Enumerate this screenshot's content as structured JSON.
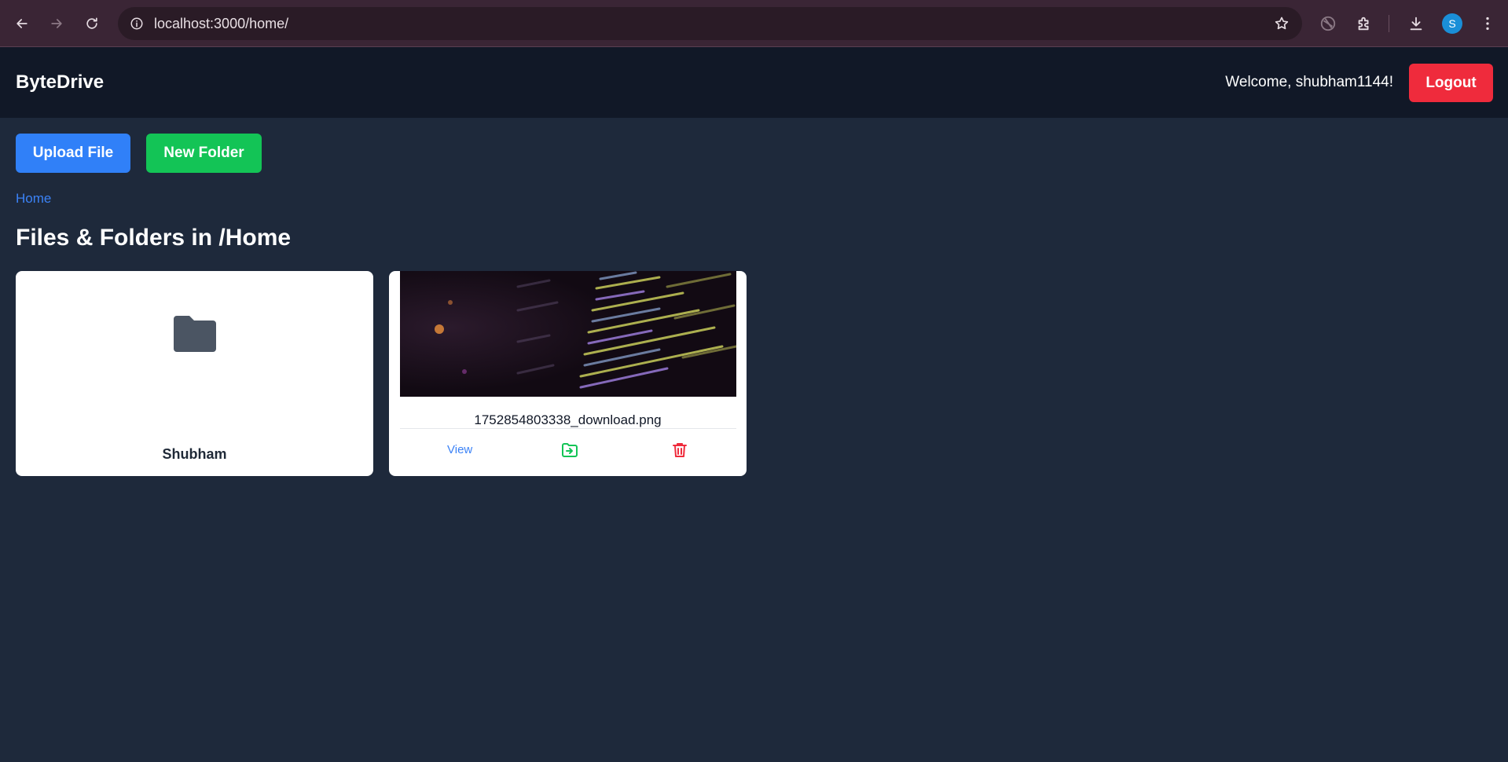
{
  "browser": {
    "url": "localhost:3000/home/",
    "profile_initial": "S",
    "icons": [
      "back-icon",
      "forward-icon",
      "reload-icon",
      "site-info-icon",
      "bookmark-star-icon",
      "browser-extension-icon",
      "extensions-icon",
      "downloads-icon",
      "menu-icon"
    ]
  },
  "header": {
    "brand": "ByteDrive",
    "welcome": "Welcome, shubham1144!",
    "logout_label": "Logout"
  },
  "toolbar": {
    "upload_label": "Upload File",
    "new_folder_label": "New Folder"
  },
  "breadcrumb": {
    "home": "Home"
  },
  "page_title": "Files & Folders in /Home",
  "items": [
    {
      "type": "folder",
      "name": "Shubham",
      "icon": "folder-icon"
    },
    {
      "type": "file",
      "name": "1752854803338_download.png",
      "actions": {
        "view": "View",
        "move_icon": "move-to-folder-icon",
        "delete_icon": "trash-icon"
      }
    }
  ],
  "colors": {
    "background": "#1e293b",
    "header": "#111827",
    "primary": "#3080f8",
    "success": "#13c456",
    "danger": "#ef2b3c",
    "link": "#3b82f6"
  }
}
